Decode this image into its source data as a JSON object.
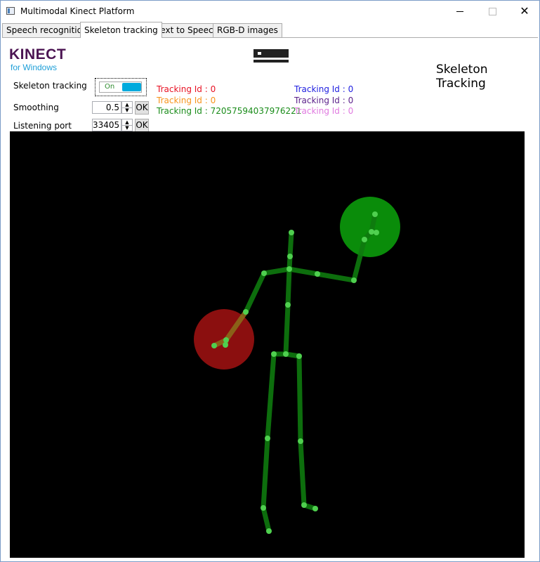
{
  "window": {
    "title": "Multimodal Kinect Platform",
    "minimize_glyph": "—",
    "close_glyph": "✕"
  },
  "tabs": [
    {
      "label": "Speech recognition",
      "active": false
    },
    {
      "label": "Skeleton tracking",
      "active": true
    },
    {
      "label": "Text to Speech",
      "active": false
    },
    {
      "label": "RGB-D images",
      "active": false
    }
  ],
  "branding": {
    "logo": "KINECT",
    "logo_sub": "for Windows",
    "sensor_icon": "kinect-sensor-icon"
  },
  "page_title": "Skeleton Tracking",
  "controls": {
    "skeleton_tracking": {
      "label": "Skeleton tracking",
      "toggle_text": "On",
      "on": true
    },
    "smoothing": {
      "label": "Smoothing",
      "value": "0.5",
      "ok_label": "OK"
    },
    "listening_port": {
      "label": "Listening port",
      "value": "33405",
      "ok_label": "OK"
    },
    "spin_up_glyph": "▲",
    "spin_down_glyph": "▼"
  },
  "tracking_ids": [
    {
      "text": "Tracking Id : 0",
      "color": "#e81123"
    },
    {
      "text": "Tracking Id : 0",
      "color": "#f7941d"
    },
    {
      "text": "Tracking Id : 72057594037976221",
      "color": "#1a8c1a"
    },
    {
      "text": "Tracking Id : 0",
      "color": "#2020e0"
    },
    {
      "text": "Tracking Id : 0",
      "color": "#5a1f8a"
    },
    {
      "text": "Tracking Id : 0",
      "color": "#e07ae0"
    }
  ],
  "colors": {
    "canvas_bg": "#000000",
    "bone": "#0f7a0f",
    "joint": "#4fd04f",
    "right_hand_state": "#8b0f0f",
    "left_hand_state": "#0a8c0a",
    "right_hand_bone": "#8a6a1a"
  }
}
